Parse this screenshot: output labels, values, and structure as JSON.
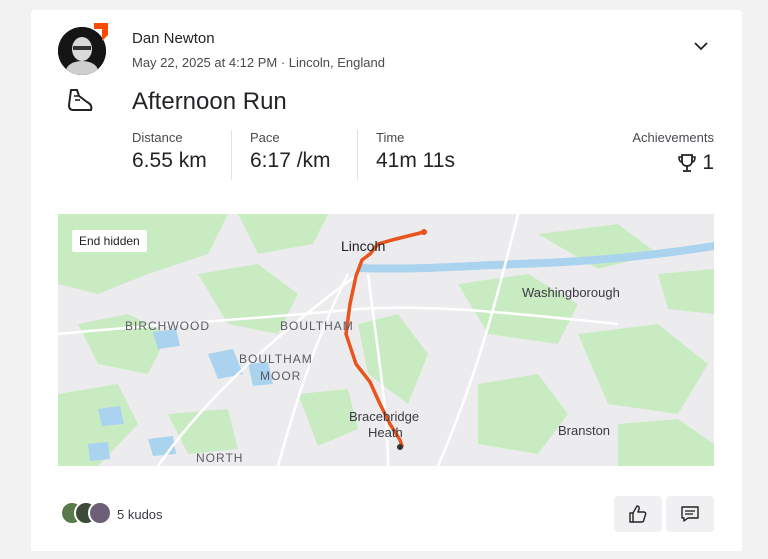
{
  "athlete": {
    "name": "Dan Newton",
    "meta": "May 22, 2025 at 4:12 PM · Lincoln, England"
  },
  "activity": {
    "type_icon": "running-shoe-icon",
    "title": "Afternoon Run"
  },
  "stats": [
    {
      "label": "Distance",
      "value": "6.55 km"
    },
    {
      "label": "Pace",
      "value": "6:17 /km"
    },
    {
      "label": "Time",
      "value": "41m 11s"
    }
  ],
  "achievements": {
    "label": "Achievements",
    "count": "1",
    "icon": "trophy-icon"
  },
  "map": {
    "badge": "End hidden",
    "labels": {
      "lincoln": "Lincoln",
      "washingborough": "Washingborough",
      "birchwood": "BIRCHWOOD",
      "boultham": "BOULTHAM",
      "boultham_moor_1": "BOULTHAM",
      "boultham_moor_2": "MOOR",
      "bracebridge_1": "Bracebridge",
      "bracebridge_2": "Heath",
      "branston": "Branston",
      "north": "NORTH"
    },
    "route_color": "#e8541c"
  },
  "kudos": {
    "text": "5 kudos"
  },
  "actions": {
    "kudos_icon": "thumbs-up-icon",
    "comment_icon": "comment-icon"
  },
  "colors": {
    "brand": "#fc4c02",
    "map_green": "#c9ebc2",
    "map_water": "#a9d3ee"
  }
}
